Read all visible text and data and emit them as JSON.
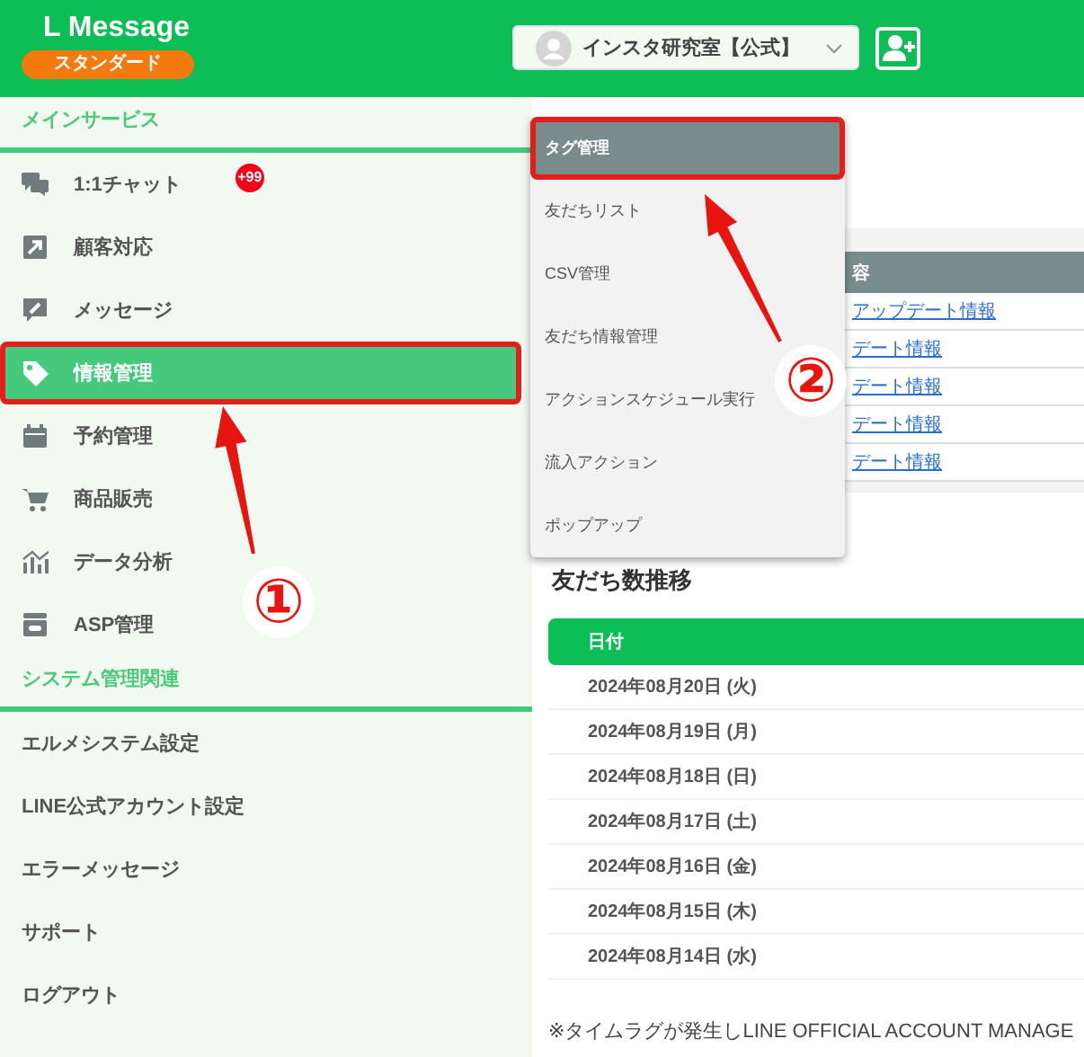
{
  "header": {
    "logo": "L Message",
    "plan_badge": "スタンダード",
    "account": {
      "name": "インスタ研究室【公式】"
    }
  },
  "sidebar": {
    "sections": [
      {
        "title": "メインサービス",
        "items": [
          {
            "label": "1:1チャット",
            "badge": "+99",
            "selected": false,
            "annotated": false
          },
          {
            "label": "顧客対応",
            "selected": false,
            "annotated": false
          },
          {
            "label": "メッセージ",
            "selected": false,
            "annotated": false
          },
          {
            "label": "情報管理",
            "selected": true,
            "annotated": true
          },
          {
            "label": "予約管理",
            "selected": false,
            "annotated": false
          },
          {
            "label": "商品販売",
            "selected": false,
            "annotated": false
          },
          {
            "label": "データ分析",
            "selected": false,
            "annotated": false
          },
          {
            "label": "ASP管理",
            "selected": false,
            "annotated": false
          }
        ]
      },
      {
        "title": "システム管理関連",
        "items": [
          {
            "label": "エルメシステム設定",
            "selected": false,
            "annotated": false
          },
          {
            "label": "LINE公式アカウント設定",
            "selected": false,
            "annotated": false
          },
          {
            "label": "エラーメッセージ",
            "selected": false,
            "annotated": false
          },
          {
            "label": "サポート",
            "selected": false,
            "annotated": false
          },
          {
            "label": "ログアウト",
            "selected": false,
            "annotated": false
          }
        ]
      }
    ]
  },
  "dropdown": {
    "items": [
      {
        "label": "タグ管理",
        "selected": true,
        "annotated": true
      },
      {
        "label": "友だちリスト",
        "selected": false,
        "annotated": false
      },
      {
        "label": "CSV管理",
        "selected": false,
        "annotated": false
      },
      {
        "label": "友だち情報管理",
        "selected": false,
        "annotated": false
      },
      {
        "label": "アクションスケジュール実行",
        "selected": false,
        "annotated": false
      },
      {
        "label": "流入アクション",
        "selected": false,
        "annotated": false
      },
      {
        "label": "ポップアップ",
        "selected": false,
        "annotated": false
      }
    ]
  },
  "news_table": {
    "column_2": "容",
    "rows": [
      {
        "link": "アップデート情報"
      },
      {
        "link": "デート情報"
      },
      {
        "link": "デート情報"
      },
      {
        "link": "デート情報"
      },
      {
        "link": "デート情報"
      }
    ]
  },
  "friends_section": {
    "title": "友だち数推移",
    "table": {
      "columns": [
        "日付"
      ],
      "rows": [
        [
          "2024年08月20日 (火)"
        ],
        [
          "2024年08月19日 (月)"
        ],
        [
          "2024年08月18日 (日)"
        ],
        [
          "2024年08月17日 (土)"
        ],
        [
          "2024年08月16日 (金)"
        ],
        [
          "2024年08月15日 (木)"
        ],
        [
          "2024年08月14日 (水)"
        ]
      ]
    }
  },
  "footer_note": "※タイムラグが発生しLINE OFFICIAL ACCOUNT MANAGE",
  "callouts": [
    {
      "number": "①"
    },
    {
      "number": "②"
    }
  ]
}
